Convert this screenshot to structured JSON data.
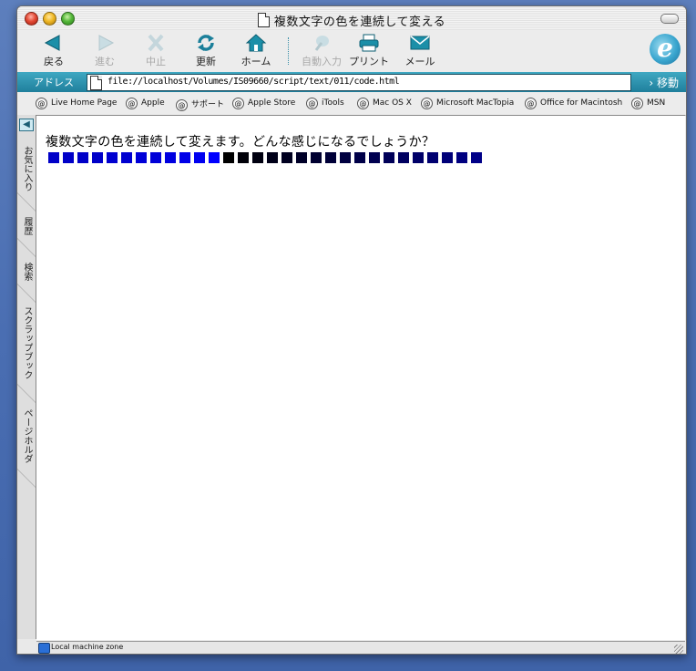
{
  "window": {
    "title": "複数文字の色を連続して変える"
  },
  "toolbar": {
    "back": "戻る",
    "forward": "進む",
    "stop": "中止",
    "refresh": "更新",
    "home": "ホーム",
    "autofill": "自動入力",
    "print": "プリント",
    "mail": "メール"
  },
  "address": {
    "label": "アドレス",
    "url": "file://localhost/Volumes/IS09660/script/text/011/code.html",
    "go": "移動"
  },
  "favorites": [
    "Live Home Page",
    "Apple",
    "サポート",
    "Apple Store",
    "iTools",
    "Mac OS X",
    "Microsoft MacTopia",
    "Office for Macintosh",
    "MSN"
  ],
  "sidebar": {
    "tabs": [
      "お気に入り",
      "履歴",
      "検索",
      "スクラップブック",
      "ページホルダ"
    ]
  },
  "page": {
    "heading": "複数文字の色を連続して変えます。どんな感じになるでしょうか？",
    "square_colors": [
      "#0000c8",
      "#0000c8",
      "#0000c8",
      "#0000c8",
      "#0000d0",
      "#0000d0",
      "#0000d8",
      "#0000d8",
      "#0000e0",
      "#0000e8",
      "#0000f0",
      "#0000ff",
      "#000000",
      "#000008",
      "#000010",
      "#000018",
      "#000020",
      "#000028",
      "#000030",
      "#000038",
      "#000040",
      "#000048",
      "#000050",
      "#000058",
      "#000060",
      "#000068",
      "#000070",
      "#000078",
      "#000080",
      "#000088"
    ]
  },
  "status": {
    "zone": "Local machine zone"
  }
}
